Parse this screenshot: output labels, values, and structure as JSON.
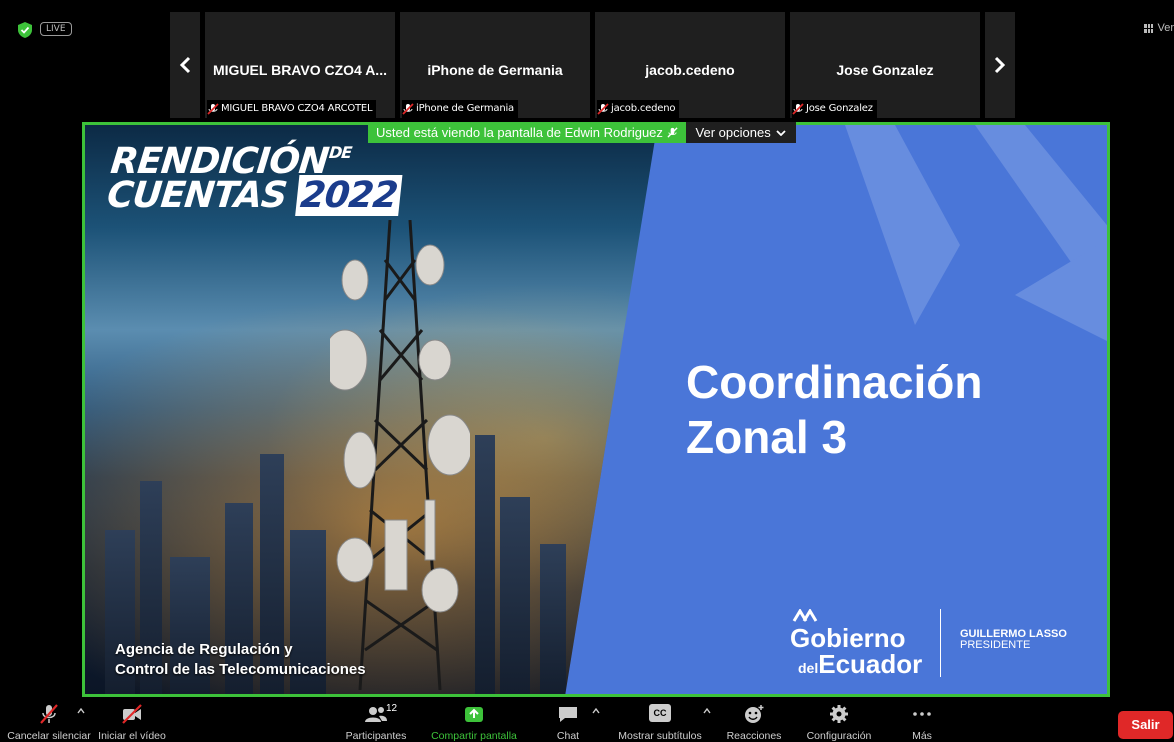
{
  "top": {
    "live_label": "LIVE",
    "view_label": "Ver"
  },
  "participants": [
    {
      "name": "MIGUEL BRAVO CZO4 A...",
      "label": "MIGUEL BRAVO CZO4 ARCOTEL"
    },
    {
      "name": "iPhone de Germania",
      "label": "iPhone de Germania"
    },
    {
      "name": "jacob.cedeno",
      "label": "jacob.cedeno"
    },
    {
      "name": "Jose Gonzalez",
      "label": "Jose Gonzalez"
    }
  ],
  "share": {
    "banner_text": "Usted está viendo la pantalla de Edwin Rodriguez",
    "options_label": "Ver opciones",
    "frame_color": "#3dc23a"
  },
  "slide": {
    "title_line1": "RENDICIÓN",
    "title_de": "DE",
    "title_line2": "CUENTAS",
    "title_year": "2022",
    "agency_line1": "Agencia de Regulación y",
    "agency_line2": "Control de las Telecomunicaciones",
    "main_line1": "Coordinación",
    "main_line2": "Zonal 3",
    "gov_line1": "Gobierno",
    "gov_del": "del",
    "gov_line2": "Ecuador",
    "president_name": "GUILLERMO LASSO",
    "president_title": "PRESIDENTE",
    "background_color": "#4a76d8"
  },
  "toolbar": {
    "mute_label": "Cancelar silenciar",
    "video_label": "Iniciar el vídeo",
    "participants_label": "Participantes",
    "participants_count": "12",
    "share_label": "Compartir pantalla",
    "chat_label": "Chat",
    "captions_label": "Mostrar subtítulos",
    "captions_icon_text": "CC",
    "reactions_label": "Reacciones",
    "settings_label": "Configuración",
    "more_label": "Más",
    "leave_label": "Salir",
    "leave_color": "#e02828"
  }
}
